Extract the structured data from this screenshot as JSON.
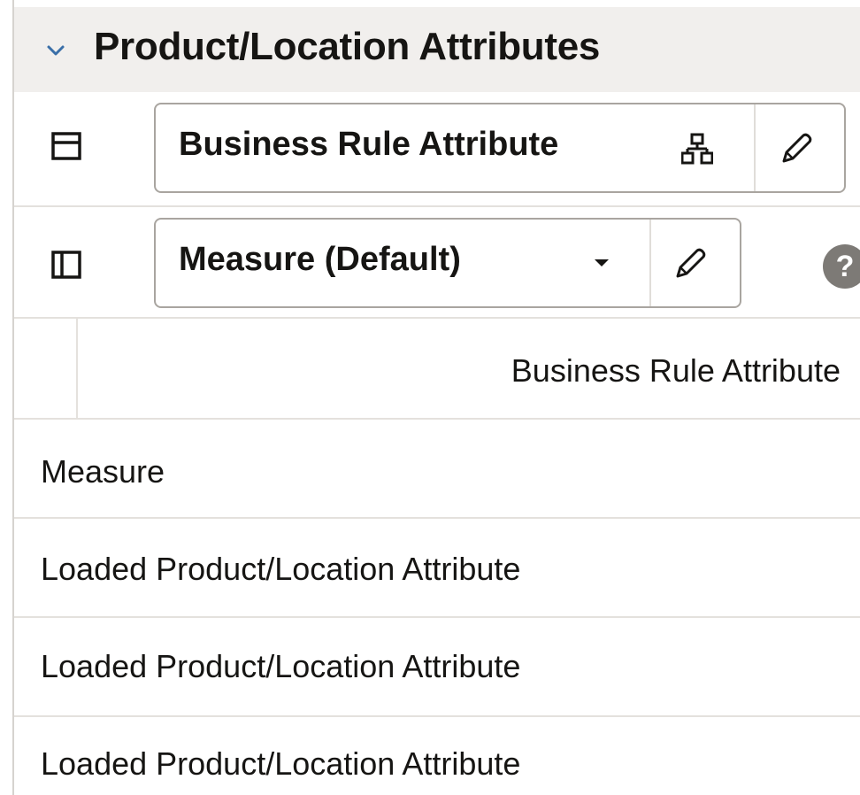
{
  "panel": {
    "title": "Product/Location Attributes"
  },
  "row_layout": {
    "selector_label": "Business Rule Attribute"
  },
  "column_layout": {
    "selector_label": "Measure (Default)",
    "help_glyph": "?"
  },
  "table": {
    "column_header": "Business Rule Attribute",
    "rows": [
      {
        "label": "Measure"
      },
      {
        "label": "Loaded Product/Location Attribute"
      },
      {
        "label": "Loaded Product/Location Attribute"
      },
      {
        "label": "Loaded Product/Location Attribute"
      }
    ]
  },
  "colors": {
    "header_background": "#f1efed",
    "border": "#a9a5a0",
    "text": "#161513",
    "help_badge": "#7d7a76"
  },
  "icons": {
    "collapse": "chevron-down-icon",
    "row_layout": "layout-rows-icon",
    "hierarchy": "hierarchy-icon",
    "edit": "pencil-icon",
    "column_layout": "layout-columns-icon",
    "dropdown": "caret-down-icon",
    "help": "help-icon"
  }
}
